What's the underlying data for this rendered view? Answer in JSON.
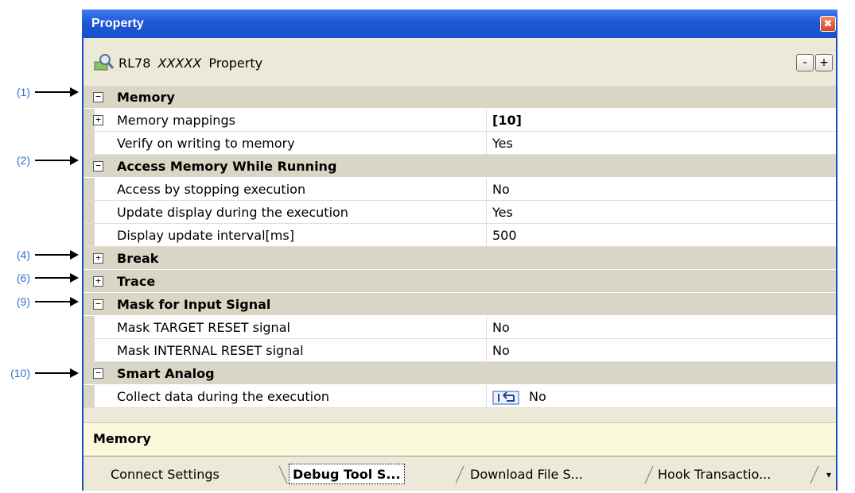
{
  "callouts": [
    "(1)",
    "(2)",
    "(4)",
    "(6)",
    "(9)",
    "(10)"
  ],
  "window": {
    "title": "Property",
    "close_glyph": "✖"
  },
  "header": {
    "prefix": "RL78",
    "placeholder": "XXXXX",
    "suffix": "Property",
    "minus": "-",
    "plus": "+",
    "icon": "property-icon"
  },
  "rows": {
    "memory": {
      "label": "Memory",
      "expander": "−"
    },
    "memory_mappings": {
      "label": "Memory mappings",
      "value": "[10]",
      "expander": "+"
    },
    "verify": {
      "label": "Verify on writing to memory",
      "value": "Yes"
    },
    "access_while_running": {
      "label": "Access Memory While Running",
      "expander": "−"
    },
    "access_stop": {
      "label": "Access by stopping execution",
      "value": "No"
    },
    "update_display": {
      "label": "Update display during the execution",
      "value": "Yes"
    },
    "update_interval": {
      "label": "Display update interval[ms]",
      "value": "500"
    },
    "break": {
      "label": "Break",
      "expander": "+"
    },
    "trace": {
      "label": "Trace",
      "expander": "+"
    },
    "mask": {
      "label": "Mask for Input Signal",
      "expander": "−"
    },
    "mask_target": {
      "label": "Mask TARGET RESET signal",
      "value": "No"
    },
    "mask_internal": {
      "label": "Mask INTERNAL RESET signal",
      "value": "No"
    },
    "smart_analog": {
      "label": "Smart Analog",
      "expander": "−"
    },
    "collect": {
      "label": "Collect data during the execution",
      "value": "No",
      "icon": "reset-default-icon"
    }
  },
  "description": {
    "title": "Memory"
  },
  "tabs": {
    "connect": "Connect Settings",
    "debug": "Debug Tool S...",
    "download": "Download File S...",
    "hook": "Hook Transactio...",
    "menu_glyph": "▾"
  },
  "colors": {
    "titlebar": "#1f58d6",
    "callout": "#2f6fd6",
    "category_row": "#d9d6c6",
    "description_bg": "#fbf9dc"
  }
}
